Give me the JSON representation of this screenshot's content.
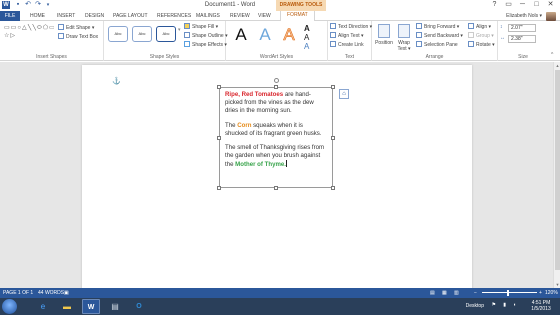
{
  "window": {
    "title": "Document1 - Word",
    "contextual_tab": "DRAWING TOOLS",
    "controls": [
      "?",
      "▭",
      "─",
      "□",
      "✕"
    ]
  },
  "quick_access": {
    "app_icon": "word-icon",
    "save": "save-icon",
    "undo": "undo-icon",
    "redo": "redo-icon"
  },
  "tabs": [
    {
      "label": "FILE"
    },
    {
      "label": "HOME"
    },
    {
      "label": "INSERT"
    },
    {
      "label": "DESIGN"
    },
    {
      "label": "PAGE LAYOUT"
    },
    {
      "label": "REFERENCES"
    },
    {
      "label": "MAILINGS"
    },
    {
      "label": "REVIEW"
    },
    {
      "label": "VIEW"
    },
    {
      "label": "FORMAT"
    }
  ],
  "user": {
    "name": "Elizabeth Nols ▾"
  },
  "ribbon": {
    "insert_shapes": {
      "label": "Insert Shapes",
      "glyphs": "▭▭○△╲╲⬭⬠▭╲⬡◯╭╮⌒⊂⊃{}☆▷",
      "edit_shape": "Edit Shape ▾",
      "draw_text_box": "Draw Text Box"
    },
    "shape_styles": {
      "label": "Shape Styles",
      "boxes": [
        "Abc",
        "Abc",
        "Abc"
      ],
      "fill": "Shape Fill ▾",
      "outline": "Shape Outline ▾",
      "effects": "Shape Effects ▾"
    },
    "wordart": {
      "label": "WordArt Styles",
      "letters": [
        "A",
        "A",
        "A"
      ]
    },
    "text": {
      "label": "Text",
      "direction": "Text Direction ▾",
      "align": "Align Text ▾",
      "link": "Create Link"
    },
    "arrange": {
      "label": "Arrange",
      "position": "Position",
      "wrap": "Wrap Text ▾",
      "bring_forward": "Bring Forward ▾",
      "send_backward": "Send Backward ▾",
      "selection_pane": "Selection Pane",
      "align": "Align ▾",
      "group": "Group ▾",
      "rotate": "Rotate ▾"
    },
    "size": {
      "label": "Size",
      "height": "2.07\"",
      "width": "2.38\""
    }
  },
  "document": {
    "paragraphs": [
      {
        "highlight": "Ripe, Red Tomatoes",
        "rest": " are hand-picked from the vines as the dew dries in the morning sun."
      },
      {
        "lead": "The ",
        "highlight": "Corn",
        "rest": " squeaks when it is shucked of its fragrant green husks."
      },
      {
        "lead": "The smell of Thanksgiving rises from the garden when you brush against the ",
        "highlight": "Mother of Thyme."
      }
    ],
    "colors": {
      "red": "#d9272e",
      "orange": "#e58a18",
      "green": "#37a34a"
    }
  },
  "status": {
    "page": "PAGE 1 OF 1",
    "words": "44 WORDS",
    "zoom": "120%",
    "zoom_minus": "−",
    "zoom_plus": "+"
  },
  "taskbar": {
    "apps": [
      "ie-icon",
      "explorer-icon",
      "word-icon",
      "outlook-icon",
      "excel-icon"
    ],
    "desktop": "Desktop",
    "time": "4:51 PM",
    "date": "1/5/2013"
  }
}
